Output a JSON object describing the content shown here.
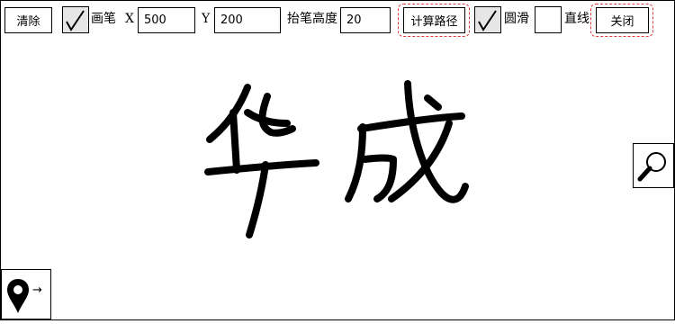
{
  "toolbar": {
    "clear_label": "清除",
    "pen_checked": true,
    "pen_label": "画笔",
    "x_label": "X",
    "x_value": "500",
    "y_label": "Y",
    "y_value": "200",
    "pen_height_label": "抬笔高度",
    "pen_height_value": "20",
    "compute_path_label": "计算路径",
    "smooth_checked": true,
    "smooth_label": "圆滑",
    "line_checked": false,
    "line_label": "直线",
    "close_label": "关闭"
  },
  "canvas": {
    "handwritten_text": "华成"
  },
  "tools": {
    "zoom_icon": "magnifier-icon",
    "location_icon": "map-pin-icon",
    "location_arrow": "→"
  },
  "colors": {
    "focus_ring": "#e23a3a",
    "checkbox_checked_bg": "#e6e6e6"
  }
}
